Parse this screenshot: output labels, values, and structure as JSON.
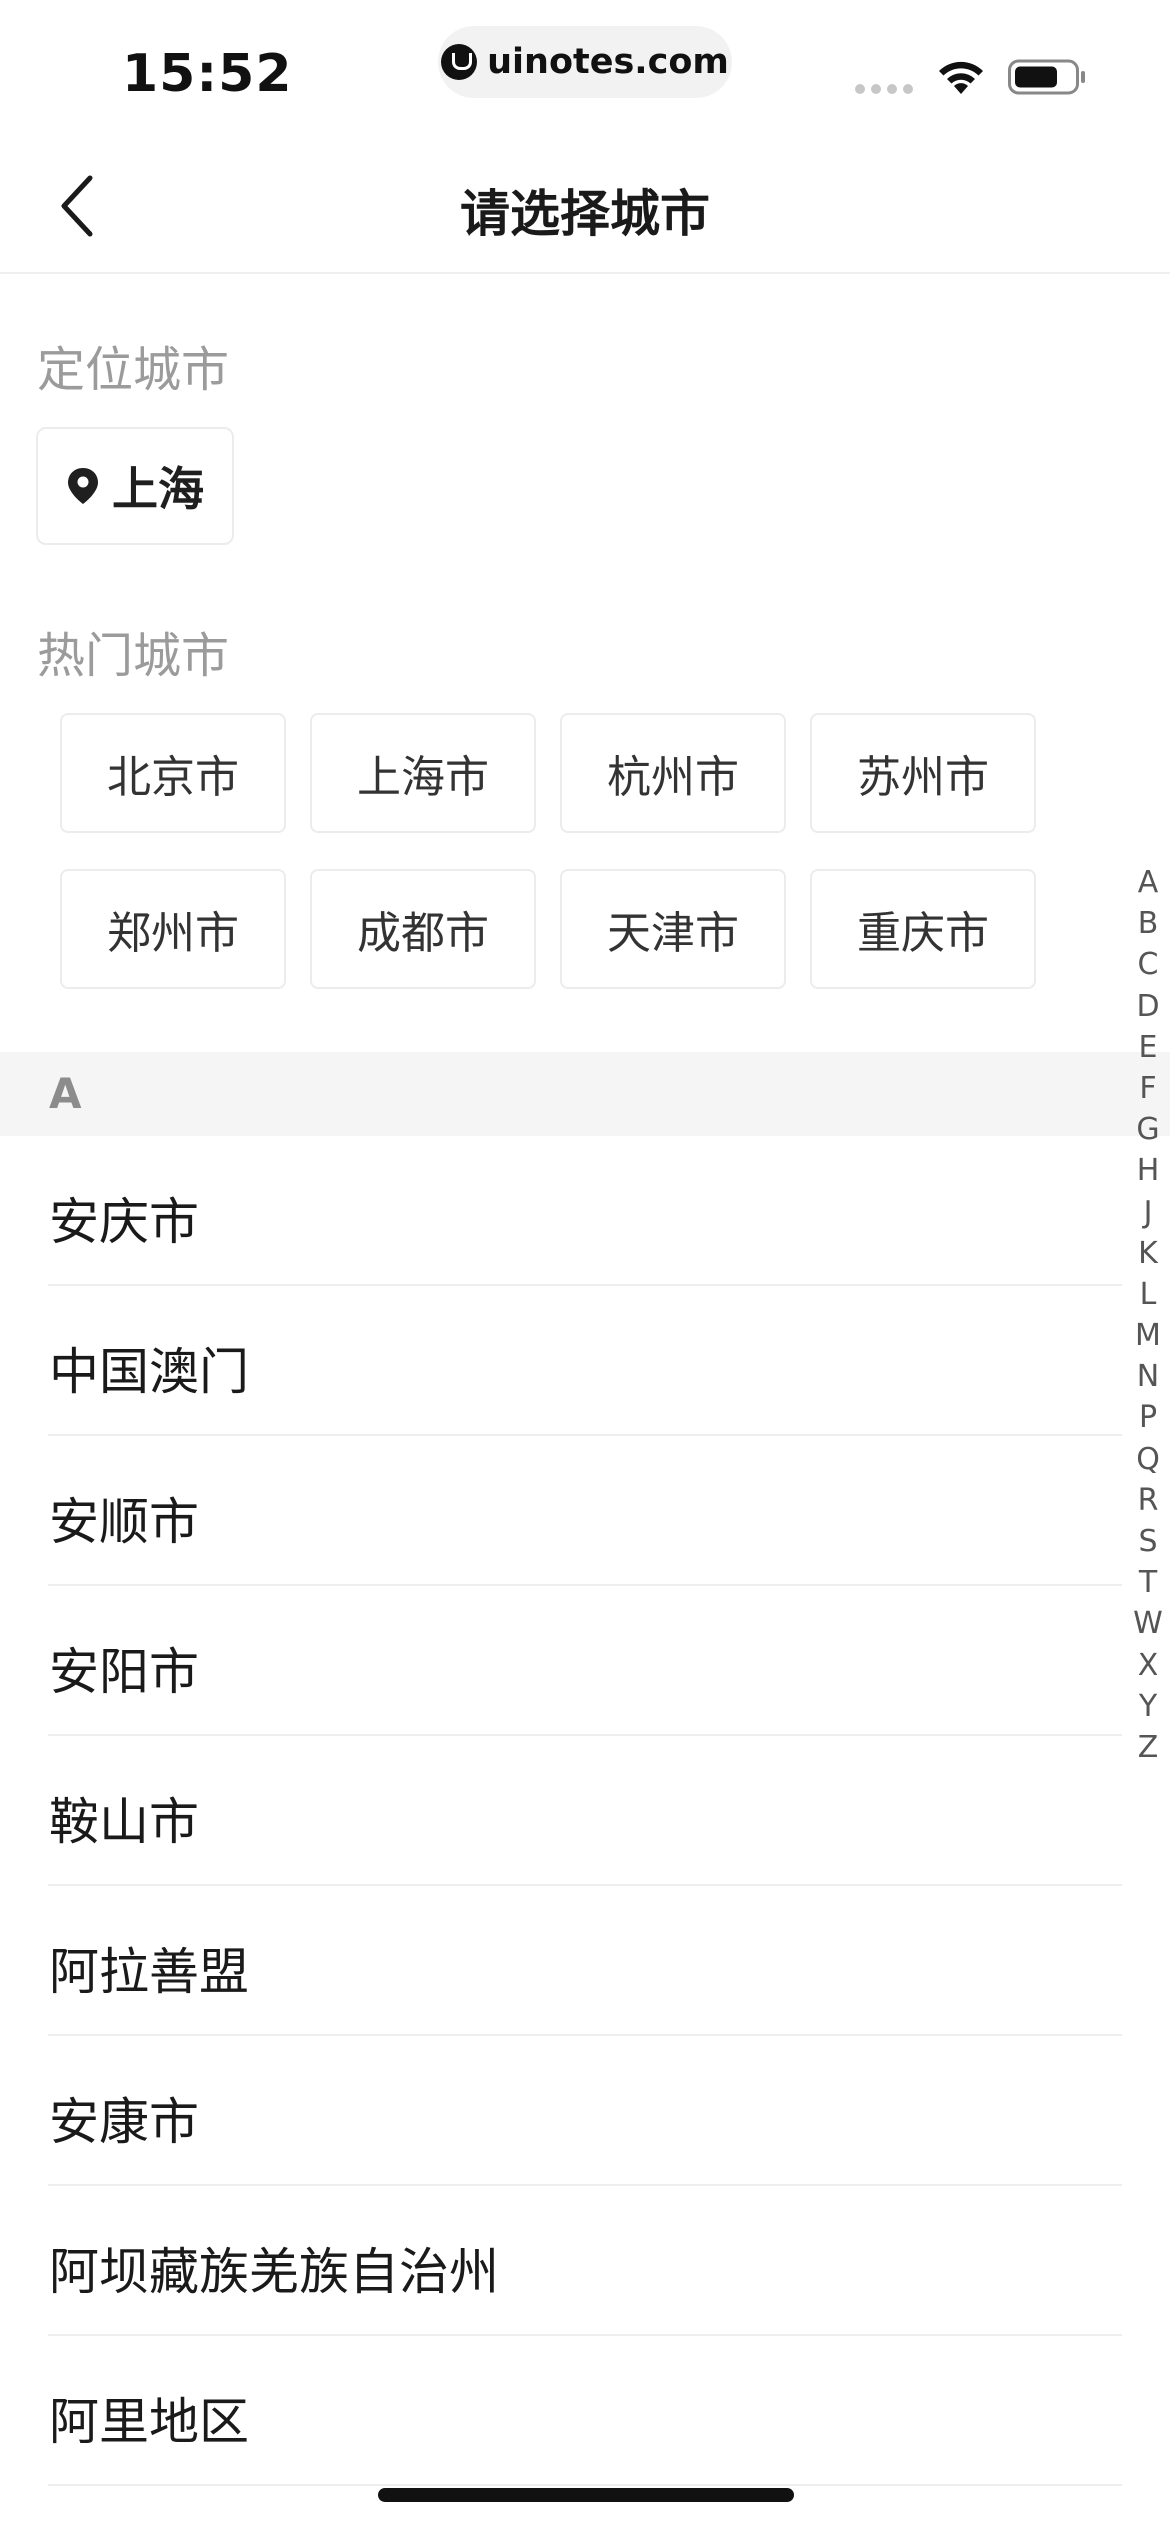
{
  "status_bar": {
    "time": "15:52",
    "url": "uinotes.com"
  },
  "nav": {
    "title": "请选择城市",
    "back_icon": "chevron-left-icon"
  },
  "location": {
    "label": "定位城市",
    "city": "上海",
    "icon": "location-pin-icon"
  },
  "hot": {
    "label": "热门城市",
    "cities": [
      "北京市",
      "上海市",
      "杭州市",
      "苏州市",
      "郑州市",
      "成都市",
      "天津市",
      "重庆市"
    ]
  },
  "list": {
    "letter": "A",
    "cities": [
      "安庆市",
      "中国澳门",
      "安顺市",
      "安阳市",
      "鞍山市",
      "阿拉善盟",
      "安康市",
      "阿坝藏族羌族自治州",
      "阿里地区"
    ]
  },
  "index": [
    "A",
    "B",
    "C",
    "D",
    "E",
    "F",
    "G",
    "H",
    "J",
    "K",
    "L",
    "M",
    "N",
    "P",
    "Q",
    "R",
    "S",
    "T",
    "W",
    "X",
    "Y",
    "Z"
  ],
  "colors": {
    "section_label": "#9b9b9b",
    "chip_border": "#ececec",
    "letter_header_bg": "#f5f5f5"
  }
}
